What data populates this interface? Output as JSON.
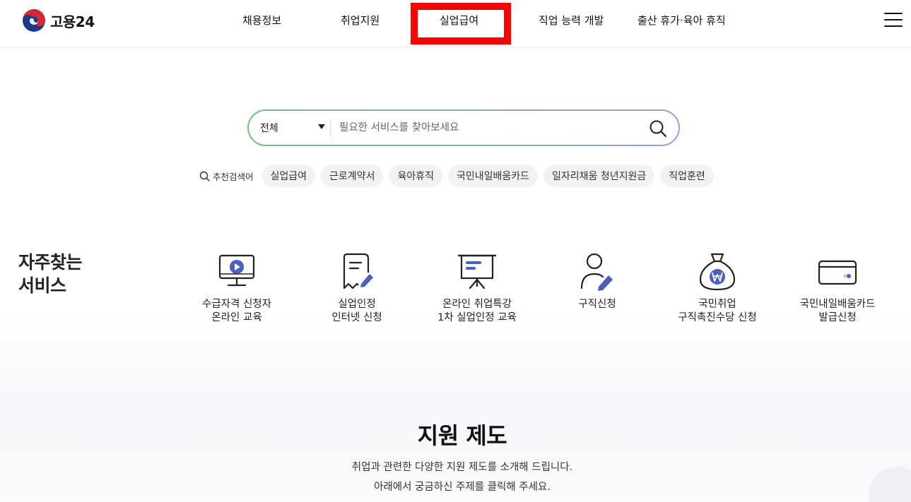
{
  "header": {
    "logo_text": "고용24",
    "nav": [
      {
        "label": "채용정보"
      },
      {
        "label": "취업지원"
      },
      {
        "label": "실업급여"
      },
      {
        "label": "직업 능력 개발"
      },
      {
        "label": "출산 휴가·육아 휴직"
      }
    ],
    "highlight_color": "#ff0000"
  },
  "search": {
    "category": "전체",
    "placeholder": "필요한 서비스를 찾아보세요",
    "gradient": [
      "#6ec27a",
      "#8ea3e0"
    ]
  },
  "recommend": {
    "label": "추천검색어",
    "chips": [
      "실업급여",
      "근로계약서",
      "육아휴직",
      "국민내일배움카드",
      "일자리채움 청년지원금",
      "직업훈련"
    ]
  },
  "favorites": {
    "title_line1": "자주찾는",
    "title_line2": "서비스",
    "accent_color": "#4a5fc1",
    "items": [
      {
        "icon": "monitor-play-icon",
        "line1": "수급자격 신청자",
        "line2": "온라인 교육"
      },
      {
        "icon": "document-pen-icon",
        "line1": "실업인정",
        "line2": "인터넷 신청"
      },
      {
        "icon": "presentation-board-icon",
        "line1": "온라인 취업특강",
        "line2": "1차 실업인정 교육"
      },
      {
        "icon": "person-pen-icon",
        "line1": "구직신청",
        "line2": ""
      },
      {
        "icon": "money-bag-icon",
        "line1": "국민취업",
        "line2": "구직촉진수당 신청"
      },
      {
        "icon": "card-icon",
        "line1": "국민내일배움카드",
        "line2": "발급신청"
      }
    ]
  },
  "support": {
    "title": "지원 제도",
    "desc1": "취업과 관련한 다양한 지원 제도를 소개해 드립니다.",
    "desc2": "아래에서 궁금하신 주제를 클릭해 주세요."
  }
}
